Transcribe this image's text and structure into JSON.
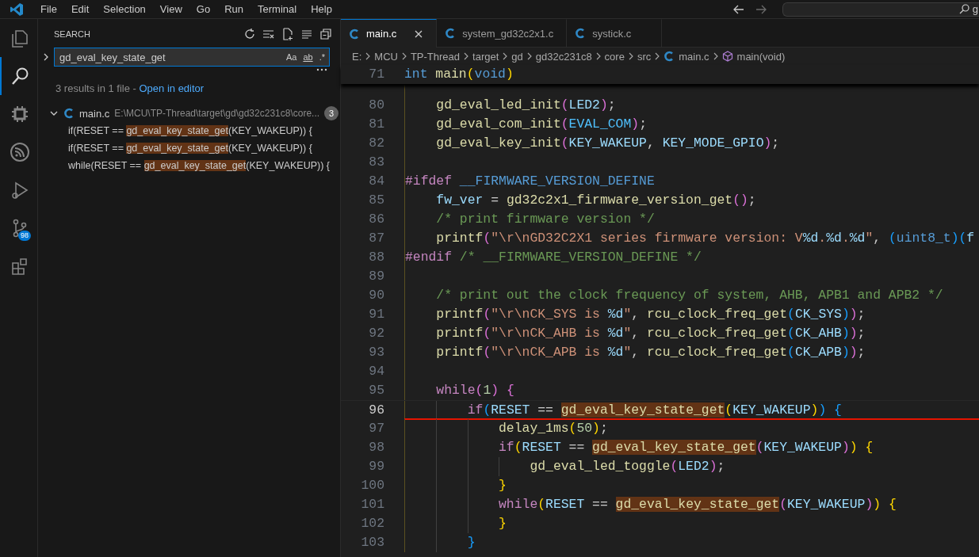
{
  "menu_bar": {
    "items": [
      "File",
      "Edit",
      "Selection",
      "View",
      "Go",
      "Run",
      "Terminal",
      "Help"
    ],
    "command_center_text": "g"
  },
  "activity_bar": [
    {
      "kind": "explorer",
      "selected": false
    },
    {
      "kind": "search",
      "selected": true
    },
    {
      "kind": "chip",
      "selected": false
    },
    {
      "kind": "signal",
      "selected": false
    },
    {
      "kind": "debug",
      "selected": false
    },
    {
      "kind": "scm",
      "selected": false,
      "badge": "98"
    },
    {
      "kind": "extensions",
      "selected": false
    }
  ],
  "search_panel": {
    "title": "SEARCH",
    "query": "gd_eval_key_state_get",
    "options": [
      "Aa",
      "ab",
      ".*"
    ],
    "summary": "3 results in 1 file - ",
    "summary_link": "Open in editor",
    "file": {
      "name": "main.c",
      "path": "E:\\MCU\\TP-Thread\\target\\gd\\gd32c231c8\\core...",
      "count": "3",
      "expanded": true
    },
    "results": [
      {
        "before": "if(RESET == ",
        "match": "gd_eval_key_state_get",
        "after": "(KEY_WAKEUP)) {"
      },
      {
        "before": "if(RESET == ",
        "match": "gd_eval_key_state_get",
        "after": "(KEY_WAKEUP)) {"
      },
      {
        "before": "while(RESET == ",
        "match": "gd_eval_key_state_get",
        "after": "(KEY_WAKEUP)) {"
      }
    ]
  },
  "tabs": [
    {
      "label": "main.c",
      "selected": true
    },
    {
      "label": "system_gd32c2x1.c",
      "selected": false
    },
    {
      "label": "systick.c",
      "selected": false
    }
  ],
  "breadcrumb": [
    {
      "kind": "folder",
      "label": "E:"
    },
    {
      "kind": "folder",
      "label": "MCU"
    },
    {
      "kind": "folder",
      "label": "TP-Thread"
    },
    {
      "kind": "folder",
      "label": "target"
    },
    {
      "kind": "folder",
      "label": "gd"
    },
    {
      "kind": "folder",
      "label": "gd32c231c8"
    },
    {
      "kind": "folder",
      "label": "core"
    },
    {
      "kind": "folder",
      "label": "src"
    },
    {
      "kind": "file",
      "label": "main.c"
    },
    {
      "kind": "symbol",
      "label": "main(void)"
    }
  ],
  "sticky_line": {
    "no": "71",
    "tokens": [
      {
        "kind": "type",
        "text": "int"
      },
      {
        "kind": "fn",
        "text": " main"
      },
      {
        "kind": "b1",
        "text": "("
      },
      {
        "kind": "type",
        "text": "void"
      },
      {
        "kind": "b1",
        "text": ")"
      }
    ]
  },
  "code_lines": [
    {
      "no": "80",
      "current": false,
      "tokens": [
        {
          "kind": "fn",
          "text": "    gd_eval_led_init"
        },
        {
          "kind": "b2",
          "text": "("
        },
        {
          "kind": "var",
          "text": "LED2"
        },
        {
          "kind": "b2",
          "text": ")"
        },
        {
          "kind": "plain",
          "text": ";"
        }
      ]
    },
    {
      "no": "81",
      "current": false,
      "tokens": [
        {
          "kind": "fn",
          "text": "    gd_eval_com_init"
        },
        {
          "kind": "b2",
          "text": "("
        },
        {
          "kind": "const",
          "text": "EVAL_COM"
        },
        {
          "kind": "b2",
          "text": ")"
        },
        {
          "kind": "plain",
          "text": ";"
        }
      ]
    },
    {
      "no": "82",
      "current": false,
      "tokens": [
        {
          "kind": "fn",
          "text": "    gd_eval_key_init"
        },
        {
          "kind": "b2",
          "text": "("
        },
        {
          "kind": "var",
          "text": "KEY_WAKEUP"
        },
        {
          "kind": "plain",
          "text": ", "
        },
        {
          "kind": "var",
          "text": "KEY_MODE_GPIO"
        },
        {
          "kind": "b2",
          "text": ")"
        },
        {
          "kind": "plain",
          "text": ";"
        }
      ]
    },
    {
      "no": "83",
      "current": false
    },
    {
      "no": "84",
      "current": false,
      "tokens": [
        {
          "kind": "kw",
          "text": "#ifdef"
        },
        {
          "kind": "macro",
          "text": " __FIRMWARE_VERSION_DEFINE"
        }
      ]
    },
    {
      "no": "85",
      "current": false,
      "tokens": [
        {
          "kind": "var",
          "text": "    fw_ver"
        },
        {
          "kind": "plain",
          "text": " = "
        },
        {
          "kind": "fn",
          "text": "gd32c2x1_firmware_version_get"
        },
        {
          "kind": "b2",
          "text": "("
        },
        {
          "kind": "b2",
          "text": ")"
        },
        {
          "kind": "plain",
          "text": ";"
        }
      ]
    },
    {
      "no": "86",
      "current": false,
      "tokens": [
        {
          "kind": "cmt",
          "text": "    /* print firmware version */"
        }
      ]
    },
    {
      "no": "87",
      "current": false,
      "tokens": [
        {
          "kind": "fn",
          "text": "    printf"
        },
        {
          "kind": "b2",
          "text": "("
        },
        {
          "kind": "str",
          "text": "\"\\r\\nGD32C2X1 series firmware version: V"
        },
        {
          "kind": "fmt",
          "text": "%d"
        },
        {
          "kind": "str",
          "text": "."
        },
        {
          "kind": "fmt",
          "text": "%d"
        },
        {
          "kind": "str",
          "text": "."
        },
        {
          "kind": "fmt",
          "text": "%d"
        },
        {
          "kind": "str",
          "text": "\""
        },
        {
          "kind": "plain",
          "text": ", "
        },
        {
          "kind": "b3",
          "text": "("
        },
        {
          "kind": "type",
          "text": "uint8_t"
        },
        {
          "kind": "b3",
          "text": ")"
        },
        {
          "kind": "b3",
          "text": "("
        },
        {
          "kind": "var",
          "text": "f"
        }
      ]
    },
    {
      "no": "88",
      "current": false,
      "tokens": [
        {
          "kind": "kw",
          "text": "#endif"
        },
        {
          "kind": "cmt",
          "text": " /* __FIRMWARE_VERSION_DEFINE */"
        }
      ]
    },
    {
      "no": "89",
      "current": false
    },
    {
      "no": "90",
      "current": false,
      "tokens": [
        {
          "kind": "cmt",
          "text": "    /* print out the clock frequency of system, AHB, APB1 and APB2 */"
        }
      ]
    },
    {
      "no": "91",
      "current": false,
      "tokens": [
        {
          "kind": "fn",
          "text": "    printf"
        },
        {
          "kind": "b2",
          "text": "("
        },
        {
          "kind": "str",
          "text": "\"\\r\\nCK_SYS is "
        },
        {
          "kind": "fmt",
          "text": "%d"
        },
        {
          "kind": "str",
          "text": "\""
        },
        {
          "kind": "plain",
          "text": ", "
        },
        {
          "kind": "fn",
          "text": "rcu_clock_freq_get"
        },
        {
          "kind": "b3",
          "text": "("
        },
        {
          "kind": "var",
          "text": "CK_SYS"
        },
        {
          "kind": "b3",
          "text": ")"
        },
        {
          "kind": "b2",
          "text": ")"
        },
        {
          "kind": "plain",
          "text": ";"
        }
      ]
    },
    {
      "no": "92",
      "current": false,
      "tokens": [
        {
          "kind": "fn",
          "text": "    printf"
        },
        {
          "kind": "b2",
          "text": "("
        },
        {
          "kind": "str",
          "text": "\"\\r\\nCK_AHB is "
        },
        {
          "kind": "fmt",
          "text": "%d"
        },
        {
          "kind": "str",
          "text": "\""
        },
        {
          "kind": "plain",
          "text": ", "
        },
        {
          "kind": "fn",
          "text": "rcu_clock_freq_get"
        },
        {
          "kind": "b3",
          "text": "("
        },
        {
          "kind": "var",
          "text": "CK_AHB"
        },
        {
          "kind": "b3",
          "text": ")"
        },
        {
          "kind": "b2",
          "text": ")"
        },
        {
          "kind": "plain",
          "text": ";"
        }
      ]
    },
    {
      "no": "93",
      "current": false,
      "tokens": [
        {
          "kind": "fn",
          "text": "    printf"
        },
        {
          "kind": "b2",
          "text": "("
        },
        {
          "kind": "str",
          "text": "\"\\r\\nCK_APB is "
        },
        {
          "kind": "fmt",
          "text": "%d"
        },
        {
          "kind": "str",
          "text": "\""
        },
        {
          "kind": "plain",
          "text": ", "
        },
        {
          "kind": "fn",
          "text": "rcu_clock_freq_get"
        },
        {
          "kind": "b3",
          "text": "("
        },
        {
          "kind": "var",
          "text": "CK_APB"
        },
        {
          "kind": "b3",
          "text": ")"
        },
        {
          "kind": "b2",
          "text": ")"
        },
        {
          "kind": "plain",
          "text": ";"
        }
      ]
    },
    {
      "no": "94",
      "current": false
    },
    {
      "no": "95",
      "current": false,
      "tokens": [
        {
          "kind": "kw",
          "text": "    while"
        },
        {
          "kind": "b2",
          "text": "("
        },
        {
          "kind": "num",
          "text": "1"
        },
        {
          "kind": "b2",
          "text": ")"
        },
        {
          "kind": "b2",
          "text": " {"
        }
      ]
    },
    {
      "no": "96",
      "current": true,
      "tokens": [
        {
          "kind": "kw",
          "text": "        if"
        },
        {
          "kind": "b3",
          "text": "("
        },
        {
          "kind": "var",
          "text": "RESET"
        },
        {
          "kind": "plain",
          "text": " == "
        },
        {
          "kind": "match",
          "text": "gd_eval_key_state_get"
        },
        {
          "kind": "b1",
          "text": "("
        },
        {
          "kind": "var",
          "text": "KEY_WAKEUP"
        },
        {
          "kind": "b1",
          "text": ")"
        },
        {
          "kind": "b3",
          "text": ")"
        },
        {
          "kind": "b3",
          "text": " {"
        }
      ]
    },
    {
      "no": "97",
      "current": false,
      "tokens": [
        {
          "kind": "fn",
          "text": "            delay_1ms"
        },
        {
          "kind": "b1",
          "text": "("
        },
        {
          "kind": "num",
          "text": "50"
        },
        {
          "kind": "b1",
          "text": ")"
        },
        {
          "kind": "plain",
          "text": ";"
        }
      ]
    },
    {
      "no": "98",
      "current": false,
      "tokens": [
        {
          "kind": "kw",
          "text": "            if"
        },
        {
          "kind": "b1",
          "text": "("
        },
        {
          "kind": "var",
          "text": "RESET"
        },
        {
          "kind": "plain",
          "text": " == "
        },
        {
          "kind": "match",
          "text": "gd_eval_key_state_get"
        },
        {
          "kind": "b2",
          "text": "("
        },
        {
          "kind": "var",
          "text": "KEY_WAKEUP"
        },
        {
          "kind": "b2",
          "text": ")"
        },
        {
          "kind": "b1",
          "text": ")"
        },
        {
          "kind": "b1",
          "text": " {"
        }
      ]
    },
    {
      "no": "99",
      "current": false,
      "tokens": [
        {
          "kind": "fn",
          "text": "                gd_eval_led_toggle"
        },
        {
          "kind": "b2",
          "text": "("
        },
        {
          "kind": "var",
          "text": "LED2"
        },
        {
          "kind": "b2",
          "text": ")"
        },
        {
          "kind": "plain",
          "text": ";"
        }
      ]
    },
    {
      "no": "100",
      "current": false,
      "tokens": [
        {
          "kind": "b1",
          "text": "            }"
        }
      ]
    },
    {
      "no": "101",
      "current": false,
      "tokens": [
        {
          "kind": "kw",
          "text": "            while"
        },
        {
          "kind": "b1",
          "text": "("
        },
        {
          "kind": "var",
          "text": "RESET"
        },
        {
          "kind": "plain",
          "text": " == "
        },
        {
          "kind": "match",
          "text": "gd_eval_key_state_get"
        },
        {
          "kind": "b2",
          "text": "("
        },
        {
          "kind": "var",
          "text": "KEY_WAKEUP"
        },
        {
          "kind": "b2",
          "text": ")"
        },
        {
          "kind": "b1",
          "text": ")"
        },
        {
          "kind": "b1",
          "text": " {"
        }
      ]
    },
    {
      "no": "102",
      "current": false,
      "tokens": [
        {
          "kind": "b1",
          "text": "            }"
        }
      ]
    },
    {
      "no": "103",
      "current": false,
      "tokens": [
        {
          "kind": "b3",
          "text": "        }"
        }
      ]
    }
  ]
}
